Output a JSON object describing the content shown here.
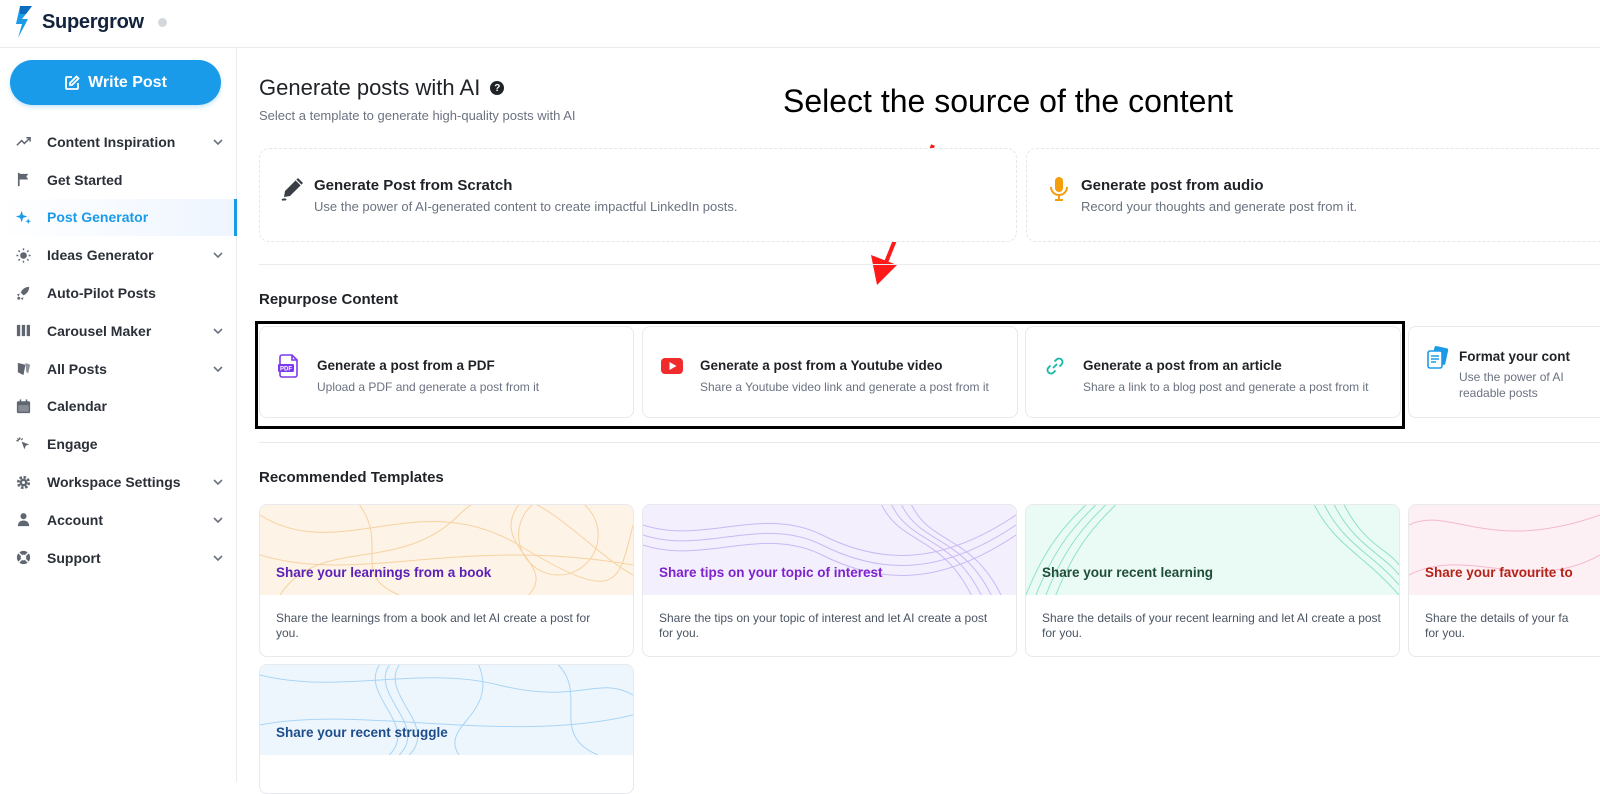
{
  "app": {
    "name": "Supergrow"
  },
  "sidebar": {
    "write_post_label": "Write Post",
    "items": [
      {
        "label": "Content Inspiration",
        "icon": "trending-up-icon",
        "has_chevron": true,
        "active": false
      },
      {
        "label": "Get Started",
        "icon": "flag-icon",
        "has_chevron": false,
        "active": false
      },
      {
        "label": "Post Generator",
        "icon": "sparkles-icon",
        "has_chevron": false,
        "active": true
      },
      {
        "label": "Ideas Generator",
        "icon": "lightbulb-icon",
        "has_chevron": true,
        "active": false
      },
      {
        "label": "Auto-Pilot Posts",
        "icon": "rocket-icon",
        "has_chevron": false,
        "active": false
      },
      {
        "label": "Carousel Maker",
        "icon": "columns-icon",
        "has_chevron": true,
        "active": false
      },
      {
        "label": "All Posts",
        "icon": "posts-icon",
        "has_chevron": true,
        "active": false
      },
      {
        "label": "Calendar",
        "icon": "calendar-icon",
        "has_chevron": false,
        "active": false
      },
      {
        "label": "Engage",
        "icon": "cursor-click-icon",
        "has_chevron": false,
        "active": false
      },
      {
        "label": "Workspace Settings",
        "icon": "gear-icon",
        "has_chevron": true,
        "active": false
      },
      {
        "label": "Account",
        "icon": "user-icon",
        "has_chevron": true,
        "active": false
      },
      {
        "label": "Support",
        "icon": "lifebuoy-icon",
        "has_chevron": true,
        "active": false
      }
    ]
  },
  "main": {
    "title": "Generate posts with AI",
    "subtitle": "Select a template to generate high-quality posts with AI",
    "annotation": "Select the source of the content",
    "generate_cards": [
      {
        "title": "Generate Post from Scratch",
        "desc": "Use the power of AI-generated content to create impactful LinkedIn posts.",
        "icon": "pen-icon"
      },
      {
        "title": "Generate post from audio",
        "desc": "Record your thoughts and generate post from it.",
        "icon": "microphone-icon"
      }
    ],
    "repurpose_title": "Repurpose Content",
    "repurpose_cards": [
      {
        "title": "Generate a post from a PDF",
        "desc": "Upload a PDF and generate a post from it",
        "icon": "pdf-icon"
      },
      {
        "title": "Generate a post from a Youtube video",
        "desc": "Share a Youtube video link and generate a post from it",
        "icon": "youtube-icon"
      },
      {
        "title": "Generate a post from an article",
        "desc": "Share a link to a blog post and generate a post from it",
        "icon": "link-icon"
      },
      {
        "title": "Format your cont",
        "desc_line1": "Use the power of AI",
        "desc_line2": "readable posts",
        "icon": "format-icon"
      }
    ],
    "templates_title": "Recommended Templates",
    "templates": [
      {
        "title": "Share your learnings from a book",
        "desc": "Share the learnings from a book and let AI create a post for you.",
        "color": "#5b21b6",
        "bg": "#fdf3e7",
        "line": "#f6cf99"
      },
      {
        "title": "Share tips on your topic of interest",
        "desc": "Share the tips on your topic of interest and let AI create a post for you.",
        "color": "#7e22ce",
        "bg": "#f3effd",
        "line": "#c9b9f5"
      },
      {
        "title": "Share your recent learning",
        "desc": "Share the details of your recent learning and let AI create a post for you.",
        "color": "#1f4d3a",
        "bg": "#eafaf4",
        "line": "#8de3c3"
      },
      {
        "title": "Share your favourite to",
        "desc": "Share the details of your fa",
        "desc2": "for you.",
        "color": "#b42318",
        "bg": "#fdf0f4",
        "line": "#f5b8cc"
      },
      {
        "title": "Share your recent struggle",
        "desc": "",
        "color": "#1e4d8c",
        "bg": "#edf6fd",
        "line": "#a9d4f5"
      }
    ]
  }
}
